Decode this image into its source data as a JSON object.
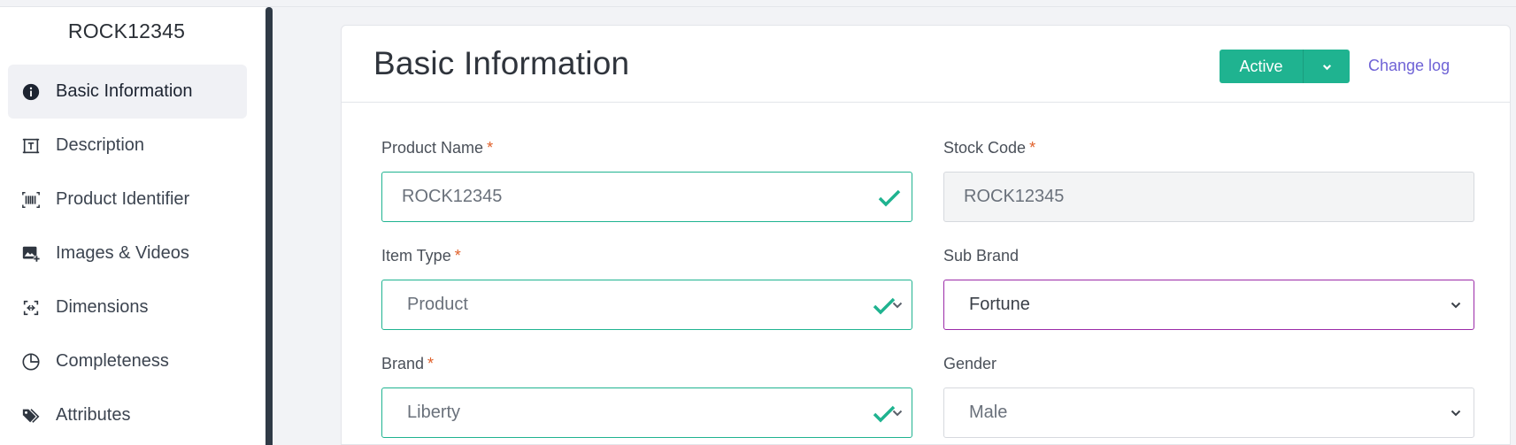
{
  "sidebar": {
    "title": "ROCK12345",
    "items": [
      {
        "label": "Basic Information",
        "icon": "info-icon",
        "active": true
      },
      {
        "label": "Description",
        "icon": "text-box-icon",
        "active": false
      },
      {
        "label": "Product Identifier",
        "icon": "barcode-icon",
        "active": false
      },
      {
        "label": "Images & Videos",
        "icon": "image-add-icon",
        "active": false
      },
      {
        "label": "Dimensions",
        "icon": "dimensions-icon",
        "active": false
      },
      {
        "label": "Completeness",
        "icon": "pie-chart-icon",
        "active": false
      },
      {
        "label": "Attributes",
        "icon": "tags-icon",
        "active": false
      }
    ]
  },
  "header": {
    "title": "Basic Information",
    "status_label": "Active",
    "change_log_label": "Change log"
  },
  "form": {
    "product_name": {
      "label": "Product Name",
      "required": "*",
      "value": "ROCK12345"
    },
    "stock_code": {
      "label": "Stock Code",
      "required": "*",
      "value": "ROCK12345"
    },
    "item_type": {
      "label": "Item Type",
      "required": "*",
      "value": "Product"
    },
    "sub_brand": {
      "label": "Sub Brand",
      "value": "Fortune"
    },
    "brand": {
      "label": "Brand",
      "required": "*",
      "value": "Liberty"
    },
    "gender": {
      "label": "Gender",
      "value": "Male"
    }
  },
  "colors": {
    "accent": "#1fb390",
    "link": "#6f63d6",
    "required": "#e0602a",
    "focus": "#9b2ba8"
  }
}
